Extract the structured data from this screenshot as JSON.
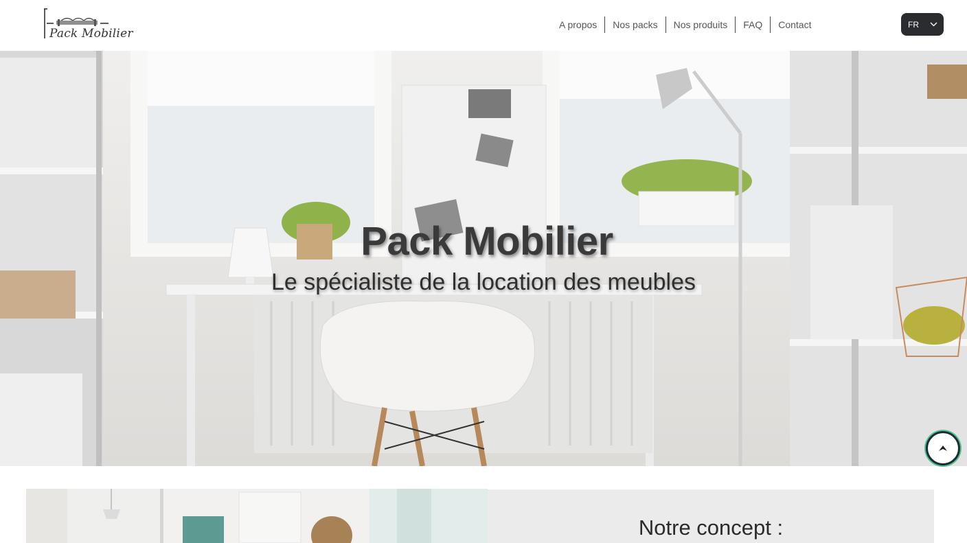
{
  "header": {
    "logo_text": "Pack Mobilier",
    "nav": [
      {
        "label": "A propos"
      },
      {
        "label": "Nos packs"
      },
      {
        "label": "Nos produits"
      },
      {
        "label": "FAQ"
      },
      {
        "label": "Contact"
      }
    ],
    "language": {
      "selected": "FR",
      "icon": "chevron-down-icon"
    }
  },
  "hero": {
    "title": "Pack Mobilier",
    "subtitle": "Le spécialiste de la location des meubles"
  },
  "scroll_top": {
    "icon": "chevron-up-icon"
  },
  "concept": {
    "title": "Notre concept :"
  }
}
